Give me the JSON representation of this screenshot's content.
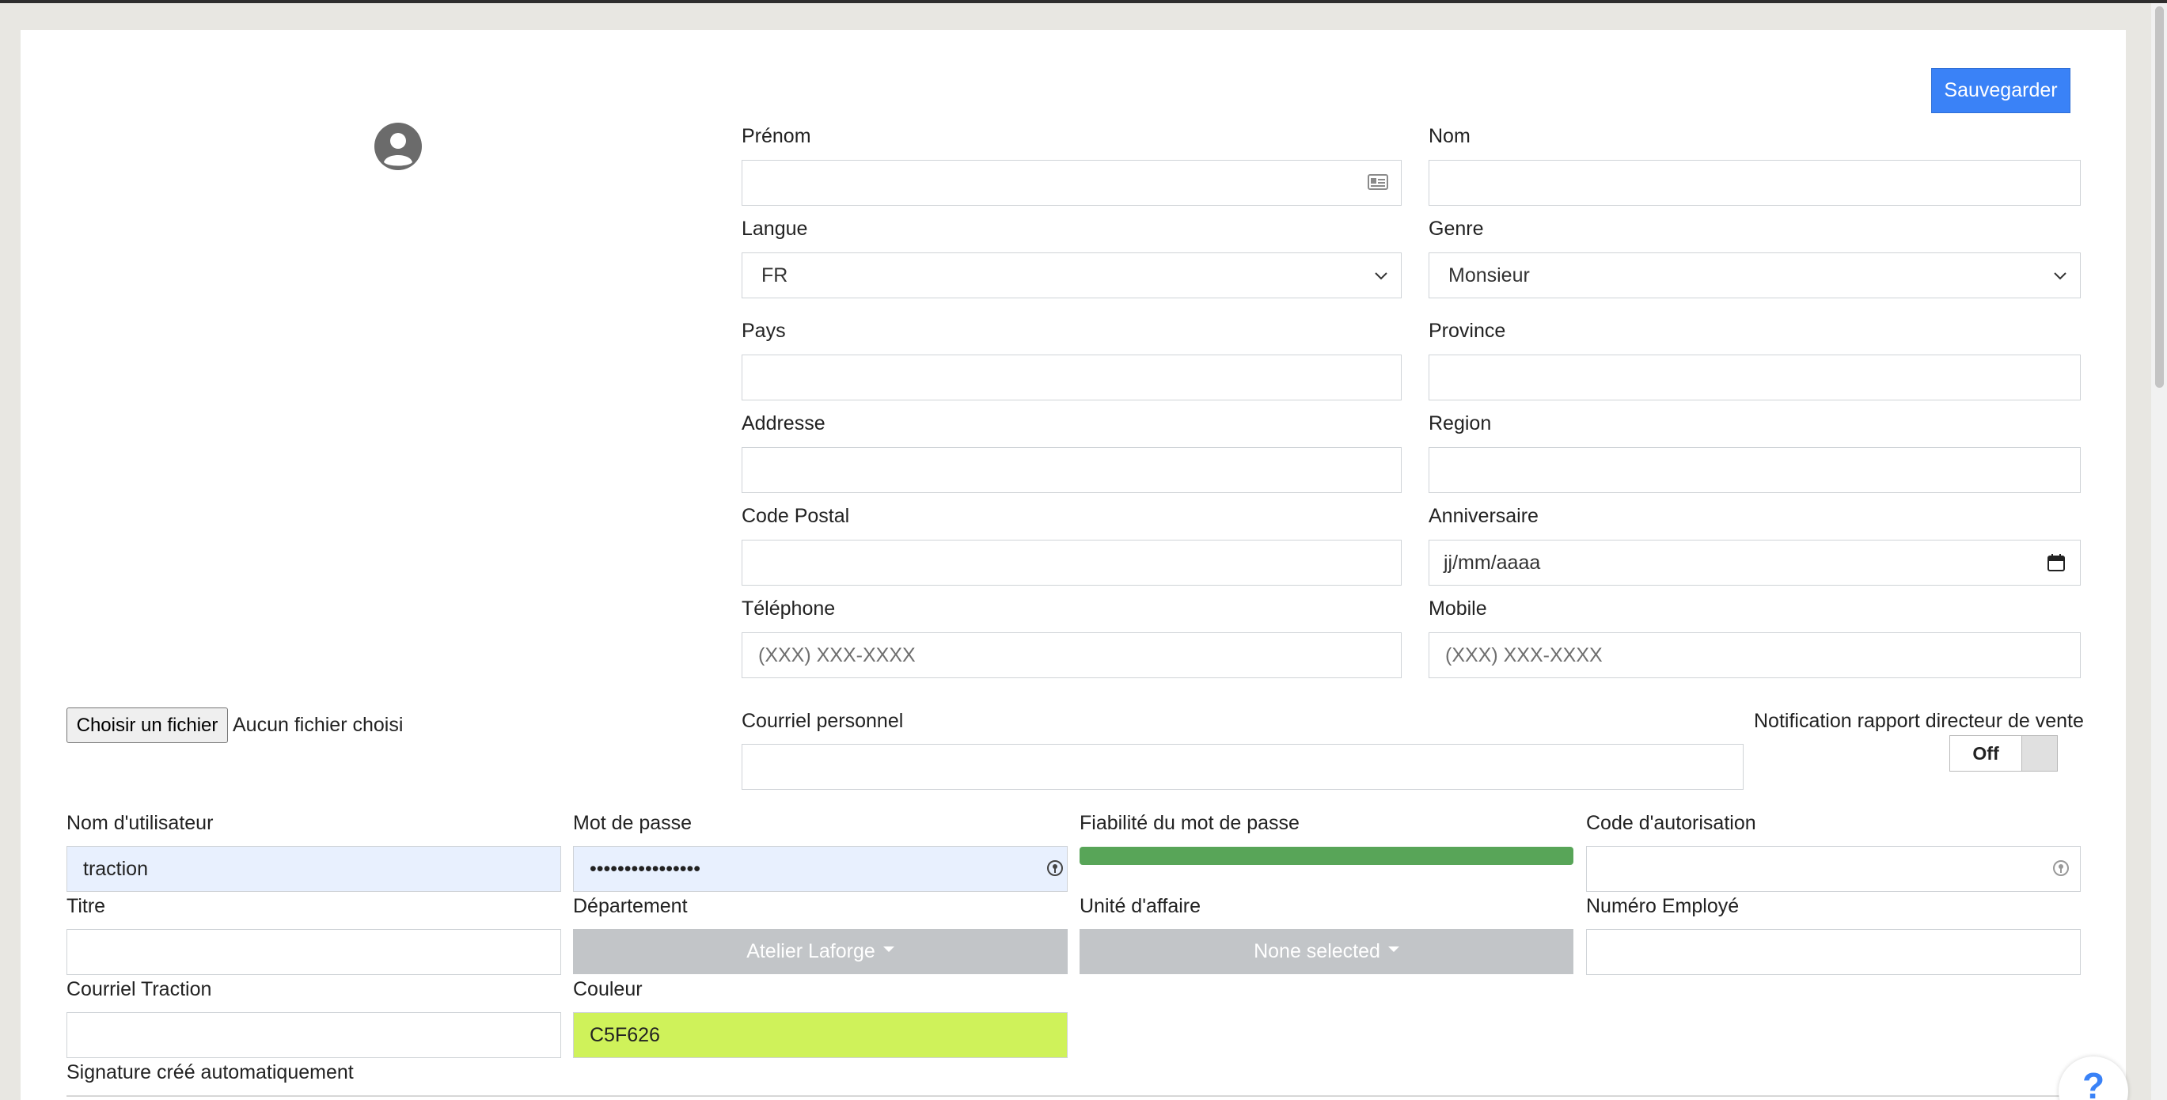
{
  "header": {
    "save_label": "Sauvegarder"
  },
  "avatar": {
    "icon": "user-circle-icon"
  },
  "profile": {
    "prenom": {
      "label": "Prénom",
      "value": ""
    },
    "nom": {
      "label": "Nom",
      "value": ""
    },
    "langue": {
      "label": "Langue",
      "selected": "FR"
    },
    "genre": {
      "label": "Genre",
      "selected": "Monsieur"
    },
    "pays": {
      "label": "Pays",
      "value": ""
    },
    "province": {
      "label": "Province",
      "value": ""
    },
    "addresse": {
      "label": "Addresse",
      "value": ""
    },
    "region": {
      "label": "Region",
      "value": ""
    },
    "code_postal": {
      "label": "Code Postal",
      "value": ""
    },
    "anniversaire": {
      "label": "Anniversaire",
      "value": "jj/mm/aaaa"
    },
    "telephone": {
      "label": "Téléphone",
      "placeholder": "(XXX) XXX-XXXX"
    },
    "mobile": {
      "label": "Mobile",
      "placeholder": "(XXX) XXX-XXXX"
    },
    "courriel_personnel": {
      "label": "Courriel personnel",
      "value": ""
    }
  },
  "file_upload": {
    "button_label": "Choisir un fichier",
    "status": "Aucun fichier choisi"
  },
  "notification": {
    "label": "Notification rapport directeur de vente",
    "state": "Off"
  },
  "account": {
    "username": {
      "label": "Nom d'utilisateur",
      "value": "traction"
    },
    "password": {
      "label": "Mot de passe",
      "value": "••••••••••••••••"
    },
    "strength": {
      "label": "Fiabilité du mot de passe",
      "level": 1.0,
      "color": "#58a558"
    },
    "auth_code": {
      "label": "Code d'autorisation",
      "value": ""
    },
    "titre": {
      "label": "Titre",
      "value": ""
    },
    "departement": {
      "label": "Département",
      "selected": "Atelier Laforge"
    },
    "unite": {
      "label": "Unité d'affaire",
      "selected": "None selected"
    },
    "numero": {
      "label": "Numéro Employé",
      "value": ""
    },
    "courriel_traction": {
      "label": "Courriel Traction",
      "value": ""
    },
    "couleur": {
      "label": "Couleur",
      "value": "C5F626",
      "color": "#cff25a"
    },
    "signature": {
      "label": "Signature créé automatiquement"
    }
  },
  "help": {
    "label": "?"
  },
  "colors": {
    "accent": "#3a82f7",
    "disabled": "#c2c5c8"
  }
}
